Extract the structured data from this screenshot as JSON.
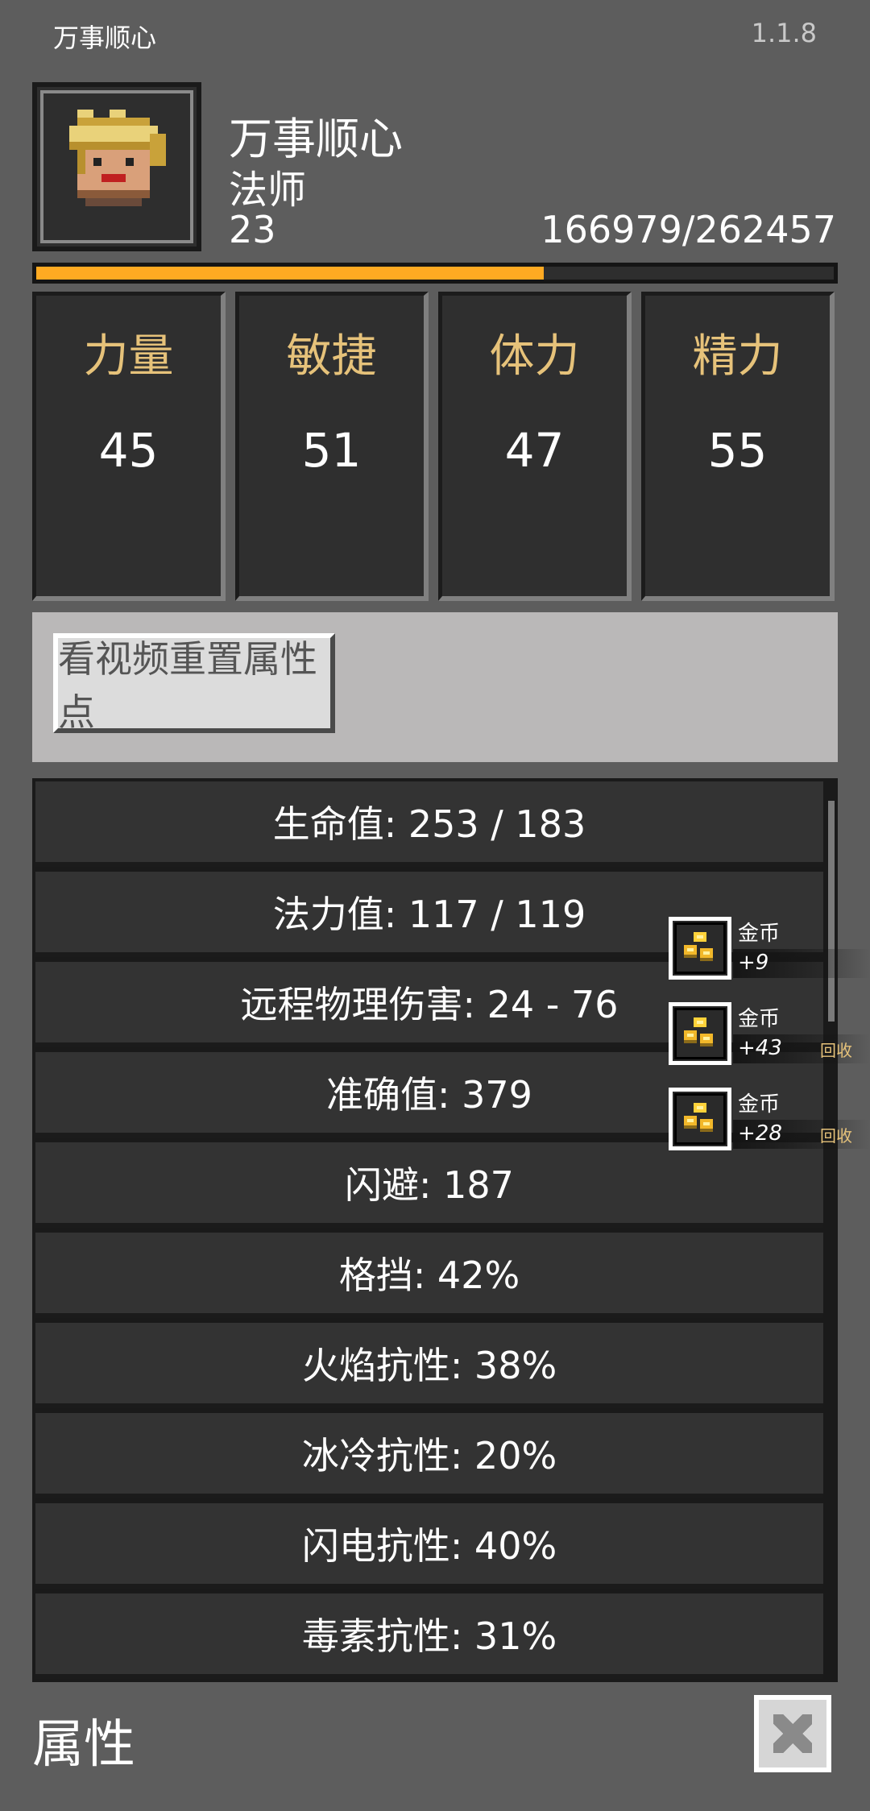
{
  "header": {
    "app_title": "万事顺心",
    "version": "1.1.8"
  },
  "player": {
    "name": "万事顺心",
    "class": "法师",
    "level": "23",
    "exp_text": "166979/262457",
    "exp_fraction": 0.636
  },
  "stats": [
    {
      "name": "力量",
      "value": "45"
    },
    {
      "name": "敏捷",
      "value": "51"
    },
    {
      "name": "体力",
      "value": "47"
    },
    {
      "name": "精力",
      "value": "55"
    }
  ],
  "reset": {
    "button_label": "看视频重置属性点"
  },
  "attributes": [
    "生命值: 253 / 183",
    "法力值: 117 / 119",
    "远程物理伤害: 24 - 76",
    "准确值: 379",
    "闪避: 187",
    "格挡: 42%",
    "火焰抗性: 38%",
    "冰冷抗性: 20%",
    "闪电抗性: 40%",
    "毒素抗性: 31%"
  ],
  "loot": [
    {
      "name": "金币",
      "amount": "+9",
      "recycle": ""
    },
    {
      "name": "金币",
      "amount": "+43",
      "recycle": "回收"
    },
    {
      "name": "金币",
      "amount": "+28",
      "recycle": "回收"
    }
  ],
  "footer": {
    "title": "属性"
  },
  "icons": {
    "avatar": "mage-portrait-icon",
    "coin": "gold-coins-icon",
    "close": "close-x-icon"
  },
  "colors": {
    "exp_bar": "#ffaa22",
    "stat_label": "#e6c27a",
    "background": "#5d5d5d"
  }
}
